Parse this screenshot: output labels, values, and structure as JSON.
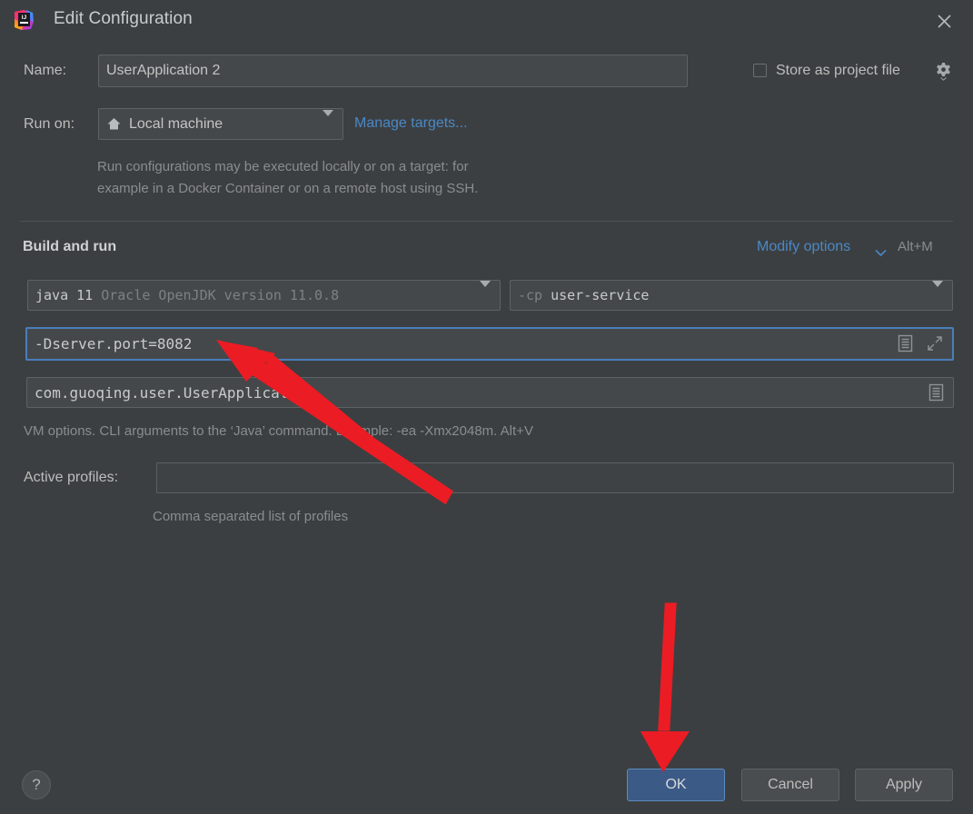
{
  "window": {
    "title": "Edit Configuration",
    "logo_icon": "intellij-idea-logo",
    "close_icon": "close-icon"
  },
  "name_row": {
    "label": "Name:",
    "value": "UserApplication 2"
  },
  "store_as_project_file": {
    "label": "Store as project file",
    "checked": false,
    "gear_icon": "gear-icon"
  },
  "run_on_row": {
    "label": "Run on:",
    "value": "Local machine",
    "machine_icon": "home-icon",
    "manage_link": "Manage targets...",
    "description_line1": "Run configurations may be executed locally or on a target: for",
    "description_line2": "example in a Docker Container or on a remote host using SSH."
  },
  "build_and_run": {
    "section_title": "Build and run",
    "modify_options_link": "Modify options",
    "modify_options_shortcut": "Alt+M",
    "jdk": {
      "primary": "java 11",
      "secondary": "Oracle OpenJDK version 11.0.8"
    },
    "classpath": {
      "prefix": "-cp",
      "module": "user-service"
    },
    "vm_options": {
      "value": "-Dserver.port=8082",
      "focused": true,
      "list_icon": "document-list-icon",
      "expand_icon": "expand-arrows-icon"
    },
    "main_class": {
      "value": "com.guoqing.user.UserApplication",
      "list_icon": "document-list-icon"
    },
    "hint": "VM options. CLI arguments to the ‘Java’ command. Example: -ea -Xmx2048m. Alt+V"
  },
  "active_profiles": {
    "label": "Active profiles:",
    "value": "",
    "hint": "Comma separated list of profiles"
  },
  "footer": {
    "help_label": "?",
    "ok_label": "OK",
    "cancel_label": "Cancel",
    "apply_label": "Apply"
  },
  "annotations": {
    "arrow_color": "#ec1c24",
    "arrow_to_vm_options": "red-arrow-pointing-to-vm-options-field",
    "arrow_to_ok_button": "red-arrow-pointing-to-ok-button"
  },
  "colors": {
    "dialog_bg": "#3c3f41",
    "field_bg": "#45484a",
    "field_border": "#5e6264",
    "focus_border": "#4a7dbd",
    "link": "#4a88c7",
    "default_button_bg": "#3c5a86",
    "text": "#bdbdbd",
    "dim_text": "#8a8d8f"
  }
}
